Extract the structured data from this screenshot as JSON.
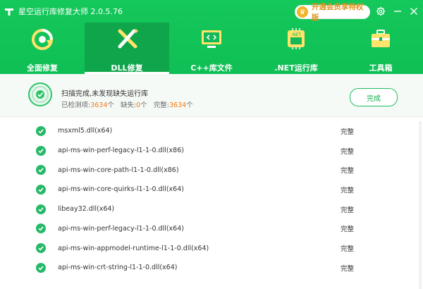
{
  "app": {
    "title": "星空运行库修复大师 2.0.5.76"
  },
  "header": {
    "vip_label": "开通会员享特权版"
  },
  "nav": {
    "items": [
      {
        "label": "全面修复",
        "icon": "refresh-icon"
      },
      {
        "label": "DLL修复",
        "icon": "wrench-icon"
      },
      {
        "label": "C++库文件",
        "icon": "code-monitor-icon"
      },
      {
        "label": ".NET运行库",
        "icon": "net-chip-icon"
      },
      {
        "label": "工具箱",
        "icon": "toolbox-icon"
      }
    ],
    "active_index": 1
  },
  "status": {
    "title": "扫描完成,未发现缺失运行库",
    "detected_label": "已检测项:",
    "detected_value": "3634",
    "detected_unit": "个",
    "missing_label": "缺失:",
    "missing_value": "0",
    "missing_unit": "个",
    "complete_label": "完整:",
    "complete_value": "3634",
    "complete_unit": "个",
    "done_button": "完成"
  },
  "list": {
    "rows": [
      {
        "name": "msxml5.dll(x64)",
        "status": "完整"
      },
      {
        "name": "api-ms-win-perf-legacy-l1-1-0.dll(x86)",
        "status": "完整"
      },
      {
        "name": "api-ms-win-core-path-l1-1-0.dll(x86)",
        "status": "完整"
      },
      {
        "name": "api-ms-win-core-quirks-l1-1-0.dll(x64)",
        "status": "完整"
      },
      {
        "name": "libeay32.dll(x64)",
        "status": "完整"
      },
      {
        "name": "api-ms-win-perf-legacy-l1-1-0.dll(x64)",
        "status": "完整"
      },
      {
        "name": "api-ms-win-appmodel-runtime-l1-1-0.dll(x64)",
        "status": "完整"
      },
      {
        "name": "api-ms-win-crt-string-l1-1-0.dll(x64)",
        "status": "完整"
      }
    ]
  },
  "colors": {
    "brand_green": "#15c85b",
    "active_green": "#0fa64b",
    "accent_orange": "#f07a18"
  }
}
